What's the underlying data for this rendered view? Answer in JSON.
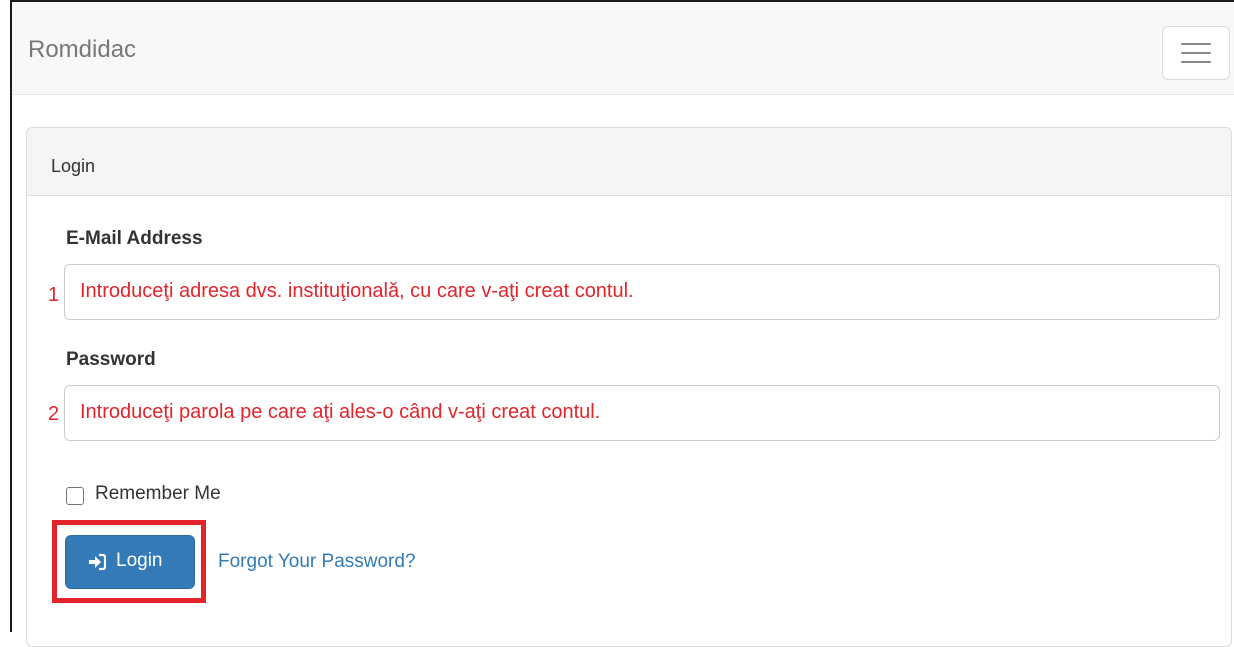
{
  "navbar": {
    "brand": "Romdidac",
    "toggle_icon": "hamburger-menu-icon"
  },
  "panel": {
    "title": "Login"
  },
  "form": {
    "email": {
      "label": "E-Mail Address",
      "marker": "1",
      "hint": "Introduceţi adresa dvs. instituţională, cu care v-aţi creat contul."
    },
    "password": {
      "label": "Password",
      "marker": "2",
      "hint": "Introduceţi parola pe care aţi ales-o când v-aţi creat contul."
    },
    "remember_label": "Remember Me",
    "remember_checked": false,
    "login_label": "Login",
    "login_icon": "sign-in-icon",
    "forgot_label": "Forgot Your Password?"
  },
  "colors": {
    "annotation": "#e3242b",
    "primary": "#337ab7",
    "link": "#337ab7"
  }
}
